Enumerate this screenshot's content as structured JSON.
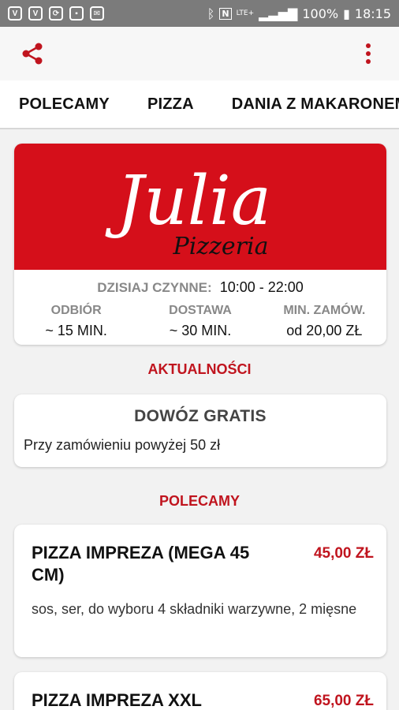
{
  "status": {
    "left_icons": [
      "v-icon",
      "v-icon",
      "refresh-icon",
      "sim-icon",
      "mail-icon"
    ],
    "lte": "LTE+",
    "battery": "100%",
    "time": "18:15"
  },
  "tabs": [
    {
      "label": "POLECAMY"
    },
    {
      "label": "PIZZA"
    },
    {
      "label": "DANIA Z MAKARONEM"
    }
  ],
  "restaurant": {
    "logo_main": "Julia",
    "logo_sub": "Pizzeria",
    "open_label": "DZISIAJ CZYNNE:",
    "open_value": "10:00 - 22:00",
    "pickup_label": "ODBIÓR",
    "pickup_value": "~ 15 MIN.",
    "delivery_label": "DOSTAWA",
    "delivery_value": "~ 30 MIN.",
    "min_label": "MIN. ZAMÓW.",
    "min_value": "od 20,00 ZŁ"
  },
  "news": {
    "section_title": "AKTUALNOŚCI",
    "title": "DOWÓZ GRATIS",
    "body": "Przy zamówieniu powyżej 50 zł"
  },
  "recommended": {
    "section_title": "POLECAMY",
    "items": [
      {
        "name": "PIZZA IMPREZA (MEGA 45 CM)",
        "price": "45,00 ZŁ",
        "description": "sos, ser, do wyboru 4 składniki warzywne, 2 mięsne"
      },
      {
        "name": "PIZZA IMPREZA XXL",
        "price": "65,00 ZŁ",
        "description": ""
      }
    ]
  },
  "colors": {
    "accent": "#c0141e",
    "banner": "#d50f1a",
    "statusbar": "#7b7b7b"
  }
}
